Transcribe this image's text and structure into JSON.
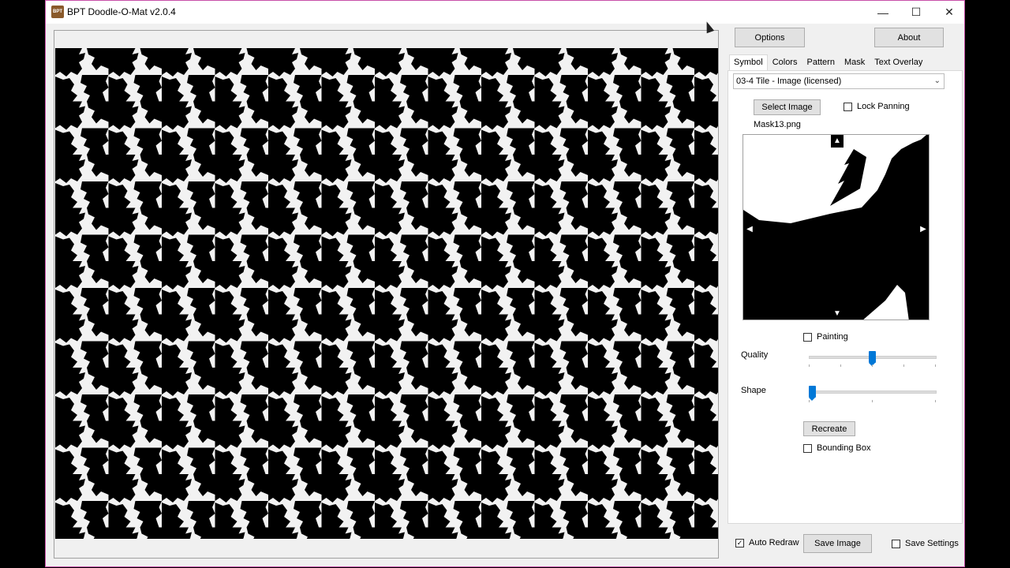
{
  "window": {
    "title": "BPT Doodle-O-Mat v2.0.4",
    "icon_text": "BPT",
    "controls": {
      "minimize": "—",
      "maximize": "☐",
      "close": "✕"
    }
  },
  "top_buttons": {
    "options": "Options",
    "about": "About"
  },
  "tabs": [
    {
      "label": "Symbol",
      "active": true
    },
    {
      "label": "Colors",
      "active": false
    },
    {
      "label": "Pattern",
      "active": false
    },
    {
      "label": "Mask",
      "active": false
    },
    {
      "label": "Text Overlay",
      "active": false
    }
  ],
  "symbol": {
    "dropdown_value": "03-4 Tile - Image (licensed)",
    "select_image_label": "Select Image",
    "lock_panning_label": "Lock Panning",
    "lock_panning_checked": false,
    "filename": "Mask13.png",
    "painting_label": "Painting",
    "painting_checked": false,
    "quality_label": "Quality",
    "quality_level": 0.5,
    "shape_label": "Shape",
    "shape_level": 0.0,
    "recreate_label": "Recreate",
    "bounding_box_label": "Bounding Box",
    "bounding_box_checked": false
  },
  "footer": {
    "auto_redraw_label": "Auto Redraw",
    "auto_redraw_checked": true,
    "save_image_label": "Save Image",
    "save_settings_label": "Save Settings",
    "save_settings_checked": false
  },
  "colors": {
    "accent": "#0078d7",
    "pattern_dark": "#000000",
    "pattern_light": "#f2f2f2"
  }
}
